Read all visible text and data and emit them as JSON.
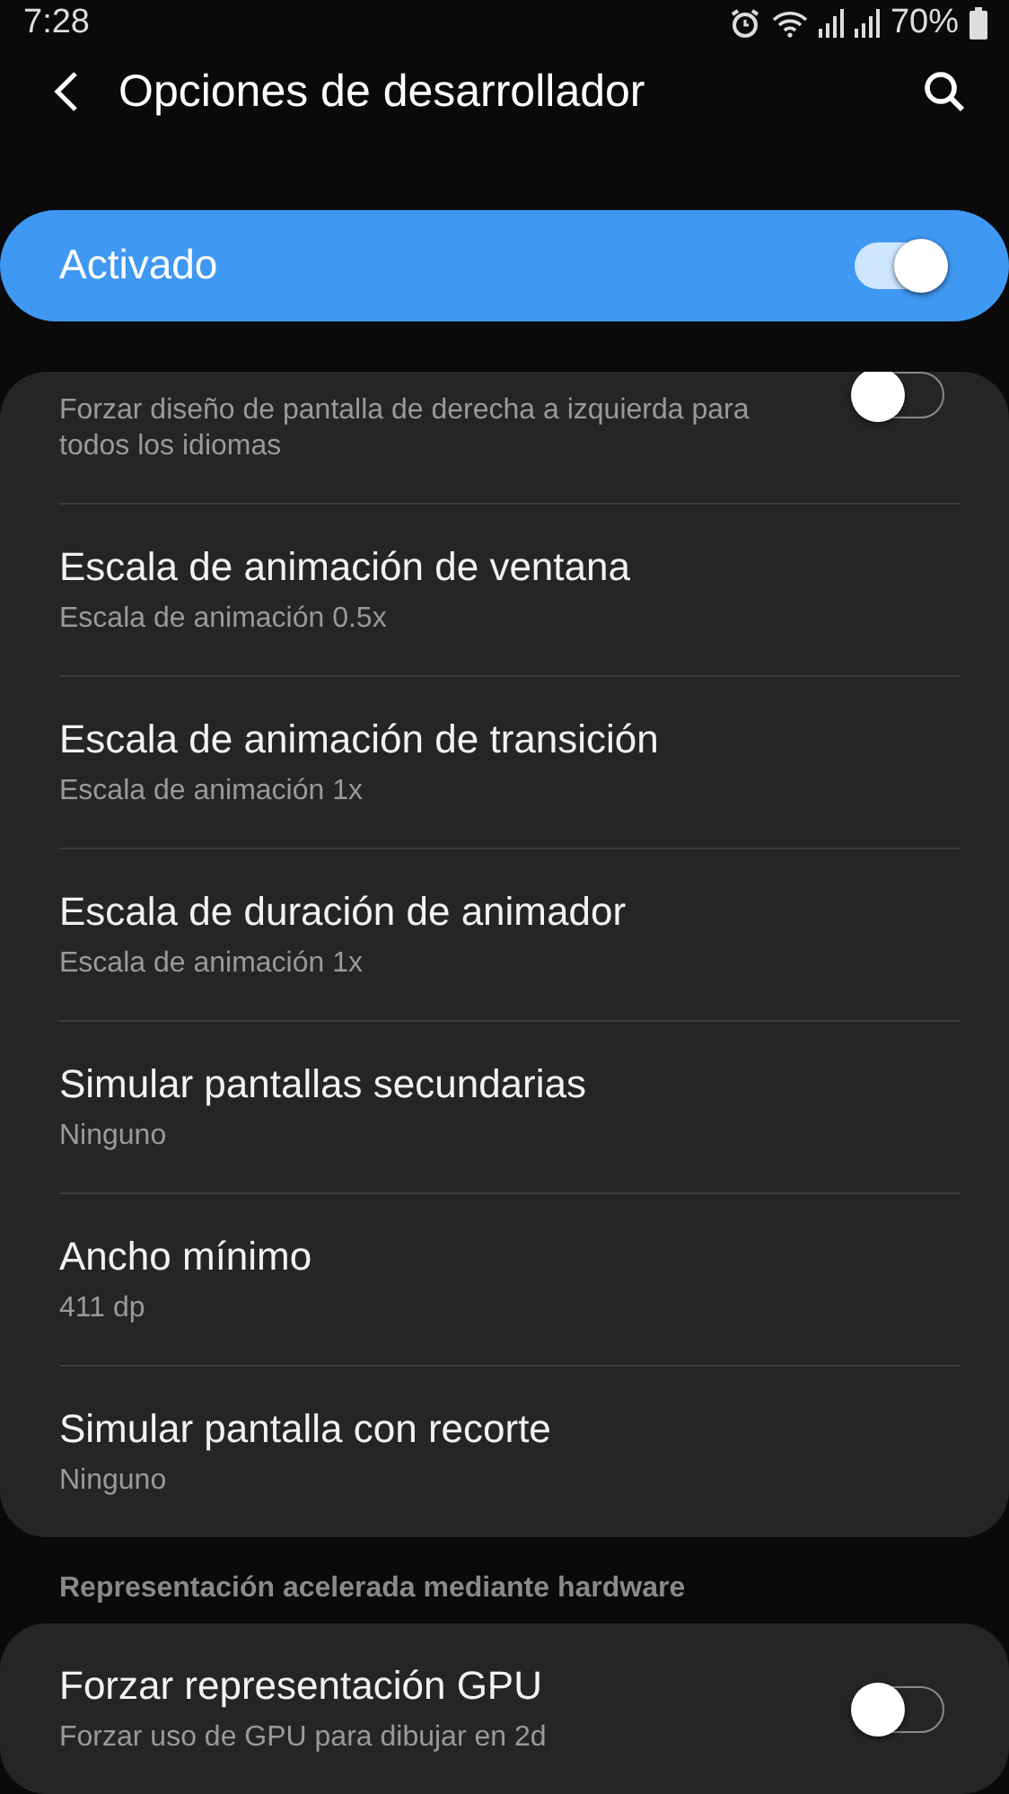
{
  "status_bar": {
    "time": "7:28",
    "battery": "70%"
  },
  "header": {
    "title": "Opciones de desarrollador"
  },
  "master": {
    "label": "Activado",
    "on": true
  },
  "groups": [
    {
      "items": [
        {
          "kind": "switch",
          "subtitle": "Forzar diseño de pantalla de derecha a izquierda para todos los idiomas",
          "on": false
        },
        {
          "kind": "option",
          "title": "Escala de animación de ventana",
          "subtitle": "Escala de animación 0.5x"
        },
        {
          "kind": "option",
          "title": "Escala de animación de transición",
          "subtitle": "Escala de animación 1x"
        },
        {
          "kind": "option",
          "title": "Escala de duración de animador",
          "subtitle": "Escala de animación 1x"
        },
        {
          "kind": "option",
          "title": "Simular pantallas secundarias",
          "subtitle": "Ninguno"
        },
        {
          "kind": "option",
          "title": "Ancho mínimo",
          "subtitle": "411 dp"
        },
        {
          "kind": "option",
          "title": "Simular pantalla con recorte",
          "subtitle": "Ninguno"
        }
      ]
    },
    {
      "heading": "Representación acelerada mediante hardware",
      "items": [
        {
          "kind": "switch",
          "title": "Forzar representación GPU",
          "subtitle": "Forzar uso de GPU para dibujar en 2d",
          "on": false
        }
      ]
    }
  ]
}
